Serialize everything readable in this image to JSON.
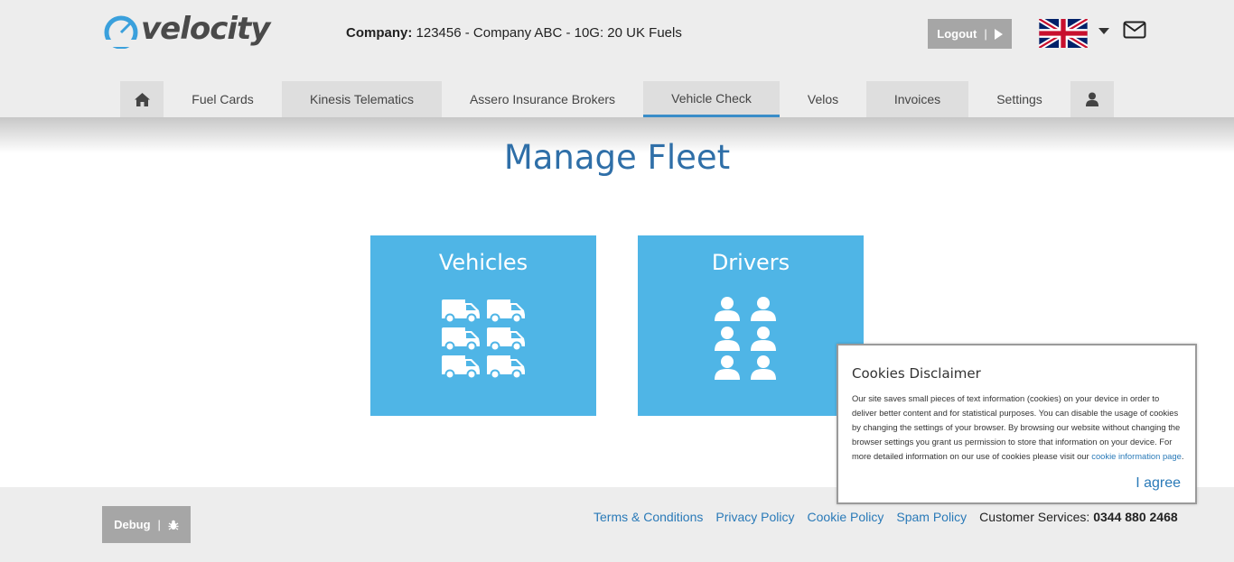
{
  "header": {
    "logo_text": "velocity",
    "company_label": "Company:",
    "company_value": "123456 - Company ABC - 10G: 20 UK Fuels",
    "logout_label": "Logout",
    "logout_sep": "|"
  },
  "nav": {
    "items": [
      {
        "label": ""
      },
      {
        "label": "Fuel Cards"
      },
      {
        "label": "Kinesis Telematics"
      },
      {
        "label": "Assero Insurance Brokers"
      },
      {
        "label": "Vehicle Check"
      },
      {
        "label": "Velos"
      },
      {
        "label": "Invoices"
      },
      {
        "label": "Settings"
      },
      {
        "label": ""
      }
    ],
    "active": "Vehicle Check"
  },
  "main": {
    "title": "Manage Fleet",
    "tiles": [
      {
        "title": "Vehicles",
        "icon": "vans-icon"
      },
      {
        "title": "Drivers",
        "icon": "drivers-icon"
      }
    ]
  },
  "cookie": {
    "title": "Cookies Disclaimer",
    "body": "Our site saves small pieces of text information (cookies) on your device in order to deliver better content and for statistical purposes. You can disable the usage of cookies by changing the settings of your browser. By browsing our website without changing the browser settings you grant us permission to store that information on your device. For more detailed information on our use of cookies please visit our",
    "link": "cookie information page",
    "tail": ".",
    "agree": "I agree"
  },
  "footer": {
    "debug_label": "Debug",
    "debug_sep": "|",
    "links": [
      "Terms & Conditions",
      "Privacy Policy",
      "Cookie Policy",
      "Spam Policy"
    ],
    "cs_label": "Customer Services:",
    "cs_phone": "0344 880 2468"
  },
  "colors": {
    "accent": "#2f6fa8",
    "tile": "#4fb5e6",
    "link": "#2a7ab8",
    "button_grey": "#a6a6a6"
  }
}
